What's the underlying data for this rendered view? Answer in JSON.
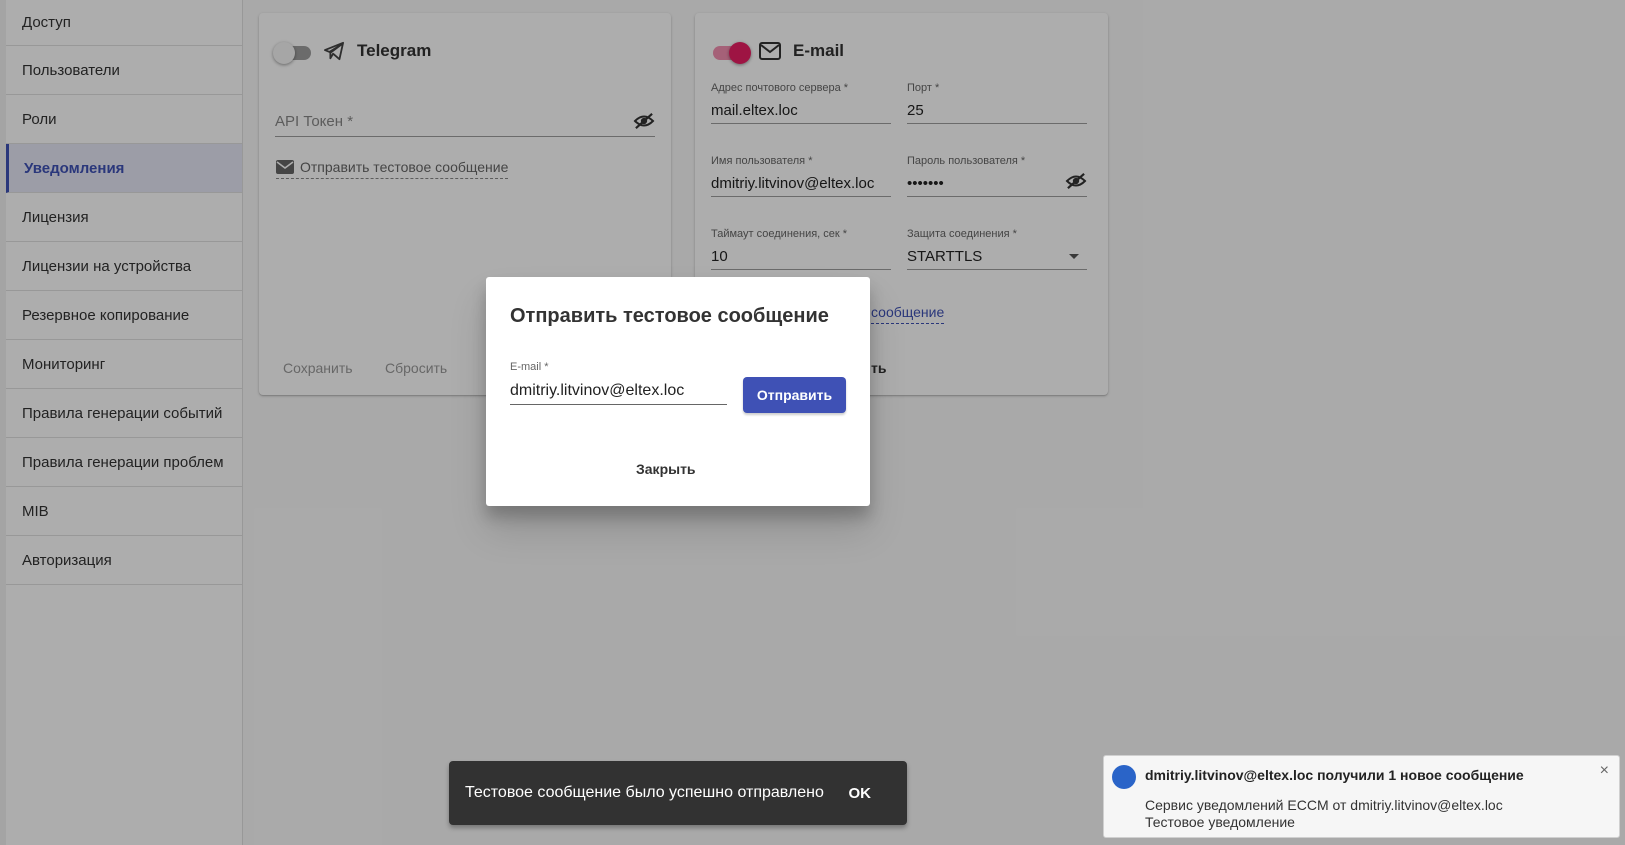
{
  "sidebar": {
    "items": [
      {
        "label": "Доступ"
      },
      {
        "label": "Пользователи"
      },
      {
        "label": "Роли"
      },
      {
        "label": "Уведомления"
      },
      {
        "label": "Лицензия"
      },
      {
        "label": "Лицензии на устройства"
      },
      {
        "label": "Резервное копирование"
      },
      {
        "label": "Мониторинг"
      },
      {
        "label": "Правила генерации событий"
      },
      {
        "label": "Правила генерации проблем"
      },
      {
        "label": "MIB"
      },
      {
        "label": "Авторизация"
      }
    ],
    "active_index": 3
  },
  "telegram": {
    "title": "Telegram",
    "enabled": false,
    "api_token_placeholder": "API Токен *",
    "test_link": "Отправить тестовое сообщение",
    "save": "Сохранить",
    "reset": "Сбросить"
  },
  "email": {
    "title": "E-mail",
    "enabled": true,
    "server_label": "Адрес почтового сервера *",
    "server_value": "mail.eltex.loc",
    "port_label": "Порт *",
    "port_value": "25",
    "user_label": "Имя пользователя *",
    "user_value": "dmitriy.litvinov@eltex.loc",
    "password_label": "Пароль пользователя *",
    "password_value": "•••••••",
    "timeout_label": "Таймаут соединения, сек *",
    "timeout_value": "10",
    "security_label": "Защита соединения *",
    "security_value": "STARTTLS",
    "test_link_partial": "сообщение",
    "reset_partial": "ть"
  },
  "dialog": {
    "title": "Отправить тестовое сообщение",
    "email_label": "E-mail *",
    "email_value": "dmitriy.litvinov@eltex.loc",
    "send": "Отправить",
    "close": "Закрыть"
  },
  "snackbar": {
    "message": "Тестовое сообщение было успешно отправлено",
    "ok": "OK"
  },
  "notification": {
    "title": "dmitriy.litvinov@eltex.loc получили 1 новое сообщение",
    "line1": "Сервис уведомлений ECCM от dmitriy.litvinov@eltex.loc",
    "line2": "Тестовое уведомление",
    "close": "×"
  },
  "colors": {
    "primary": "#3f51b5",
    "toggle_on": "#e91e63",
    "snackbar_bg": "#323232"
  }
}
